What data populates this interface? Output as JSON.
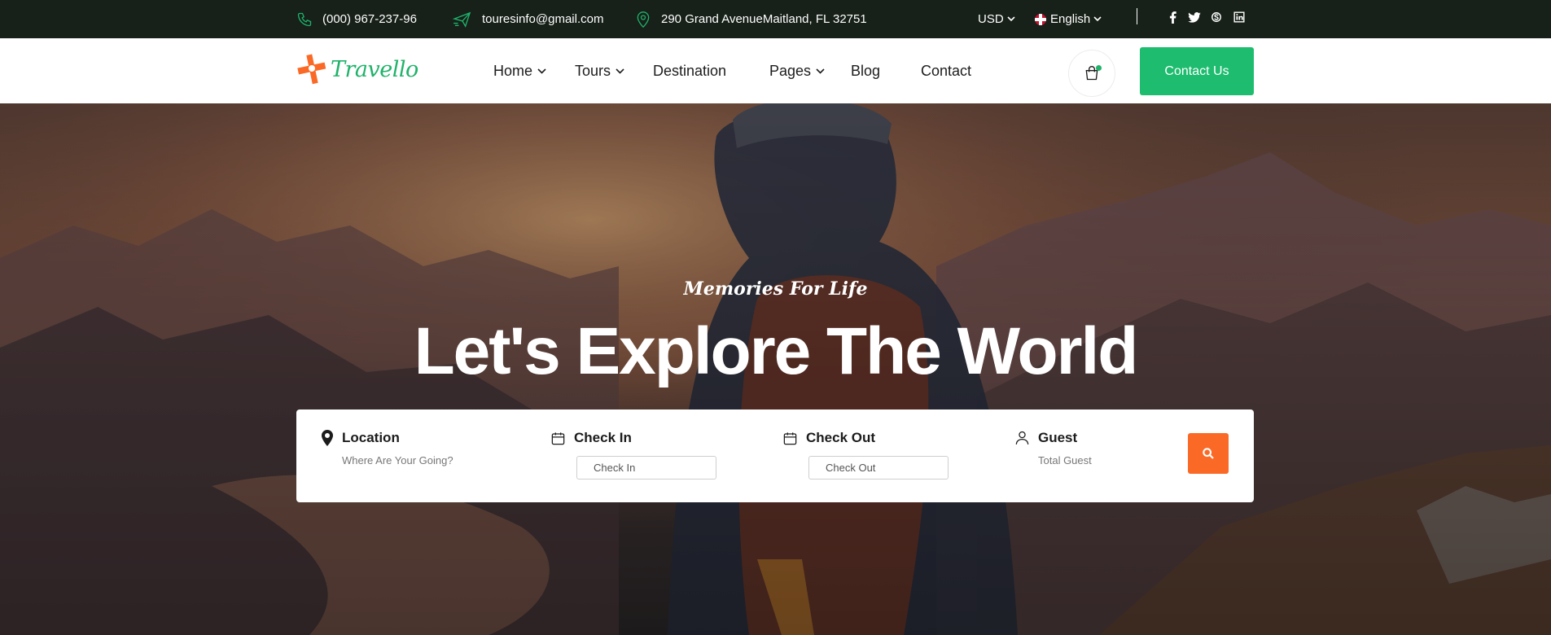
{
  "topbar": {
    "phone": "(000) 967-237-96",
    "email": "touresinfo@gmail.com",
    "address": "290 Grand AvenueMaitland, FL 32751",
    "currency": "USD",
    "language": "English",
    "social_icons": [
      "facebook-icon",
      "twitter-icon",
      "skype-icon",
      "linkedin-icon"
    ]
  },
  "header": {
    "logo_text": "Travello",
    "nav": [
      {
        "label": "Home",
        "has_dropdown": true
      },
      {
        "label": "Tours",
        "has_dropdown": true
      },
      {
        "label": "Destination",
        "has_dropdown": false
      },
      {
        "label": "Pages",
        "has_dropdown": true
      },
      {
        "label": "Blog",
        "has_dropdown": false
      },
      {
        "label": "Contact",
        "has_dropdown": false
      }
    ],
    "contact_button": "Contact Us"
  },
  "hero": {
    "tagline": "Memories For Life",
    "headline": "Let's Explore The World"
  },
  "search": {
    "location_label": "Location",
    "location_placeholder": "Where Are Your Going?",
    "checkin_label": "Check In",
    "checkin_placeholder": "Check In",
    "checkout_label": "Check Out",
    "checkout_placeholder": "Check Out",
    "guest_label": "Guest",
    "guest_placeholder": "Total Guest"
  },
  "colors": {
    "topbar_bg": "#172019",
    "brand_green": "#1dbc6e",
    "accent_orange": "#fa6a26"
  }
}
